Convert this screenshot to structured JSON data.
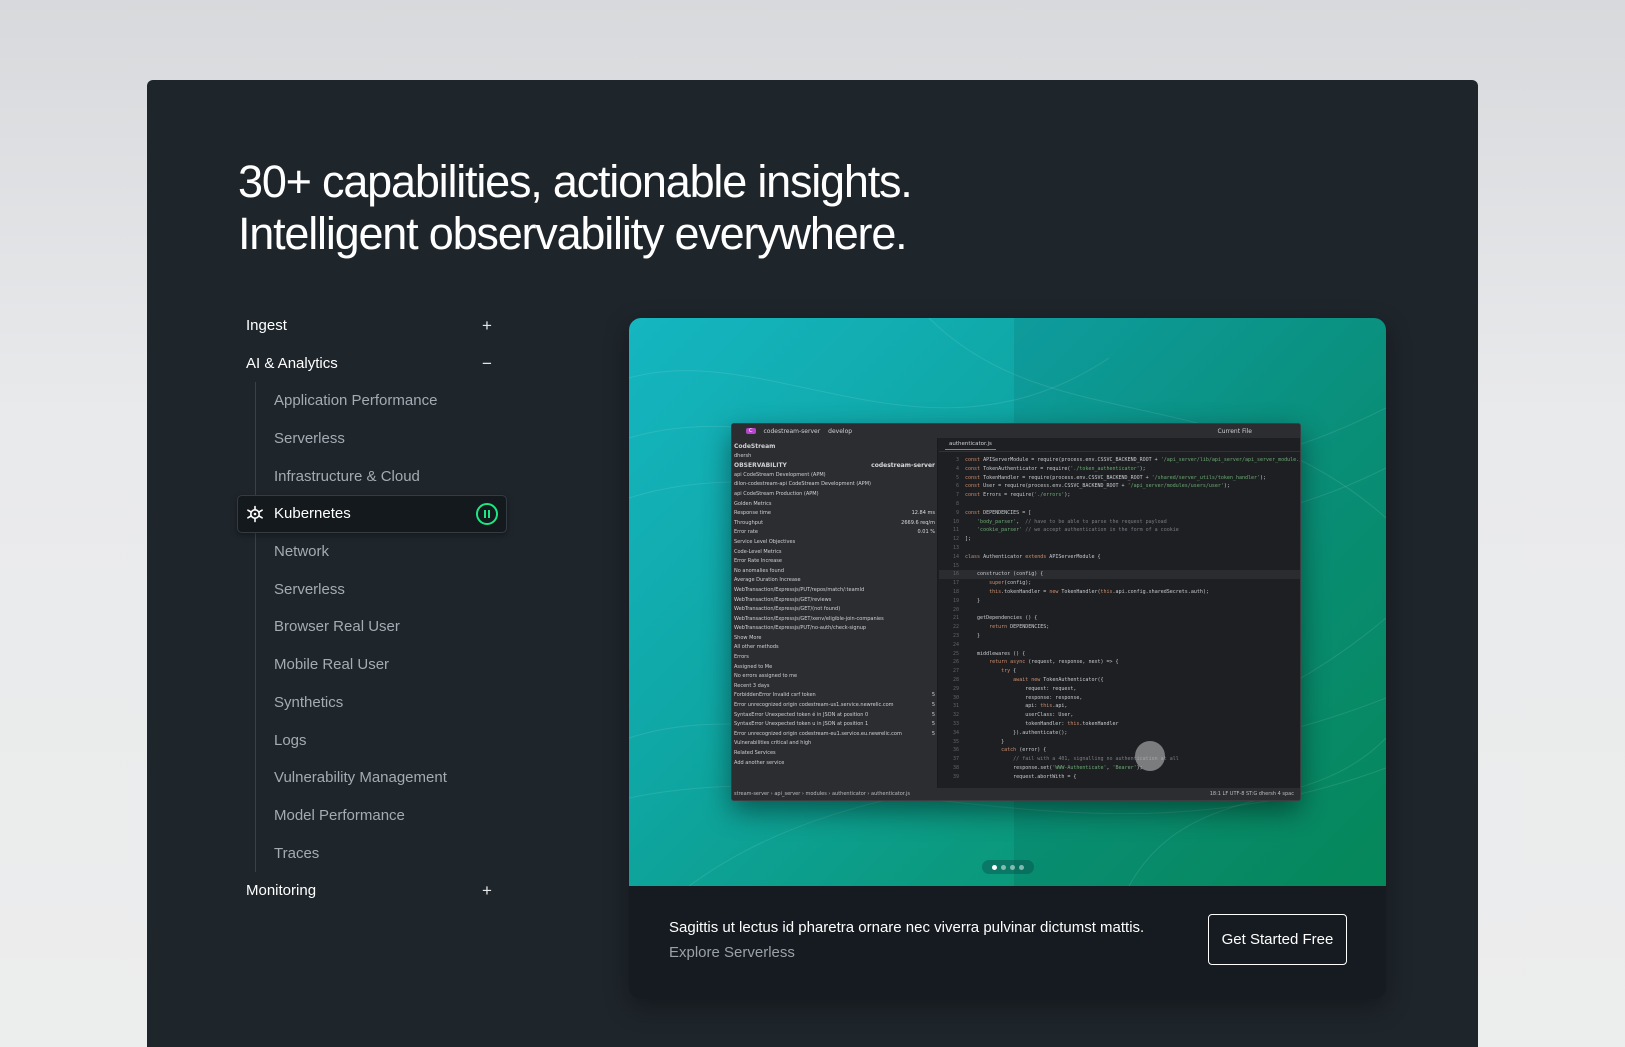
{
  "headline": {
    "line1": "30+ capabilities, actionable insights.",
    "line2": "Intelligent observability everywhere."
  },
  "nav": {
    "groups": [
      {
        "label": "Ingest",
        "toggle": "+"
      },
      {
        "label": "AI & Analytics",
        "toggle": "−"
      },
      {
        "label": "Monitoring",
        "toggle": "+"
      }
    ],
    "items": [
      "Application Performance",
      "Serverless",
      "Infrastructure & Cloud",
      "Kubernetes",
      "Network",
      "Serverless",
      "Browser Real User",
      "Mobile Real User",
      "Synthetics",
      "Logs",
      "Vulnerability Management",
      "Model Performance",
      "Traces"
    ],
    "active_index": 3,
    "active_icon": "kubernetes-icon",
    "pause_icon": "pause-icon"
  },
  "media": {
    "ide": {
      "project": "codestream-server",
      "branch": "develop",
      "run_config": "Current File",
      "left_title": "CodeStream",
      "user": "dhersh",
      "section": "OBSERVABILITY",
      "repo": "codestream-server",
      "services": [
        "api CodeStream Development (APM)",
        "dilon-codestream-api CodeStream Development (APM)",
        "api CodeStream Production (APM)"
      ],
      "golden_metrics": "Golden Metrics",
      "metrics": [
        {
          "name": "Response time",
          "value": "12.84 ms"
        },
        {
          "name": "Throughput",
          "value": "2669.6 req/m"
        },
        {
          "name": "Error rate",
          "value": "0.01 %"
        }
      ],
      "tree": [
        "Service Level Objectives",
        "Code-Level Metrics",
        "Error Rate Increase",
        "No anomalies found",
        "Average Duration Increase"
      ],
      "transactions": [
        "WebTransaction/Expressjs/PUT/repos/match/:teamId",
        "WebTransaction/Expressjs/GET/reviews",
        "WebTransaction/Expressjs/GET/(not found)",
        "WebTransaction/Expressjs/GET/xenv/eligible-join-companies",
        "WebTransaction/Expressjs/PUT/no-auth/check-signup"
      ],
      "tree2": [
        "Show More",
        "All other methods",
        "Errors",
        "Assigned to Me",
        "No errors assigned to me",
        "Recent 3 days"
      ],
      "errors": [
        {
          "type": "ForbiddenError",
          "msg": "Invalid csrf token",
          "count": "5"
        },
        {
          "type": "Error",
          "msg": "unrecognized origin codestream-us1.service.newrelic.com",
          "count": "5"
        },
        {
          "type": "SyntaxError",
          "msg": "Unexpected token é in JSON at position 0",
          "count": "5"
        },
        {
          "type": "SyntaxError",
          "msg": "Unexpected token u in JSON at position 1",
          "count": "5"
        },
        {
          "type": "Error",
          "msg": "unrecognized origin codestream-eu1.service.eu.newrelic.com",
          "count": "5"
        }
      ],
      "tree3": [
        "Vulnerabilities critical and high",
        "Related Services",
        "Add another service"
      ],
      "file_tab": "authenticator.js",
      "status_path": "stream-server › api_server › modules › authenticator › authenticator.js",
      "status_right": "18:1   LF   UTF-8   ST:G dhersh   4 spac"
    },
    "carousel_total": 4,
    "carousel_active": 0,
    "description": "Sagittis ut lectus id pharetra ornare nec viverra pulvinar dictumst mattis.",
    "link": "Explore Serverless",
    "cta": "Get Started Free"
  }
}
